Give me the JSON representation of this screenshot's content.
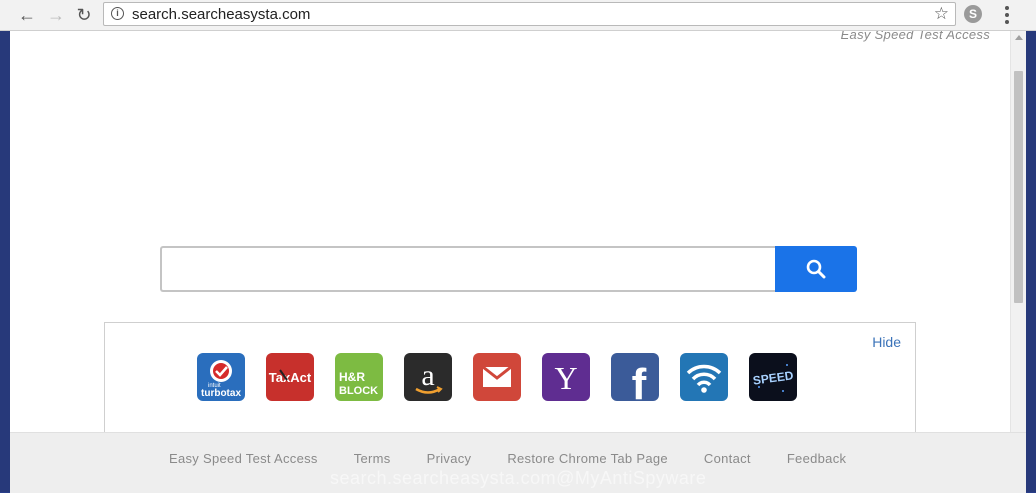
{
  "browser": {
    "url": "search.searcheasysta.com",
    "back_glyph": "←",
    "forward_glyph": "→",
    "reload_glyph": "↻",
    "star_glyph": "☆",
    "info_glyph": "i",
    "ext_glyph": "S"
  },
  "page": {
    "top_link": "Easy Speed Test Access",
    "hide_label": "Hide",
    "tiles": [
      {
        "name": "turbotax",
        "label": "turbotax",
        "sub": "intuit",
        "color": "#2a6ebd"
      },
      {
        "name": "taxact",
        "label": "TaxAct",
        "color": "#c7302c"
      },
      {
        "name": "hr-block",
        "label": "H&R BLOCK",
        "color": "#7dbb42"
      },
      {
        "name": "amazon",
        "label": "a",
        "color": "#2b2b2b"
      },
      {
        "name": "gmail",
        "label": "✉",
        "color": "#d0473a"
      },
      {
        "name": "yahoo",
        "label": "Y",
        "color": "#5f2d91"
      },
      {
        "name": "facebook",
        "label": "f",
        "color": "#3b5b99"
      },
      {
        "name": "wifi",
        "label": "wifi",
        "color": "#2376b5"
      },
      {
        "name": "speed",
        "label": "SPEED",
        "color": "#0b0f1c"
      }
    ]
  },
  "footer": {
    "links": [
      "Easy Speed Test Access",
      "Terms",
      "Privacy",
      "Restore Chrome Tab Page",
      "Contact",
      "Feedback"
    ]
  },
  "watermark": "search.searcheasysta.com@MyAntiSpyware",
  "colors": {
    "search_button": "#1a73e8",
    "link": "#3b73b9"
  }
}
